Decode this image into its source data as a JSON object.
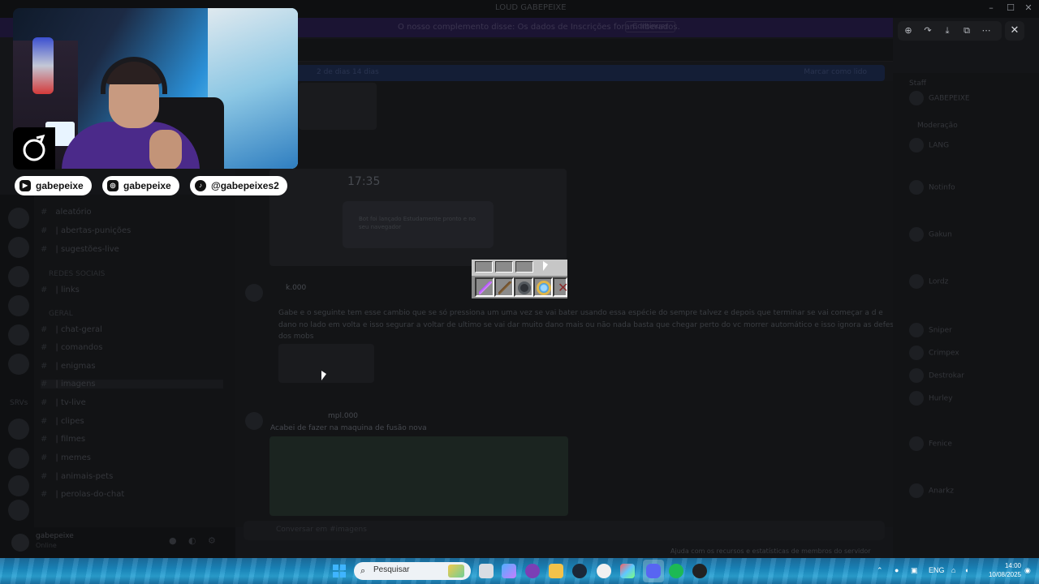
{
  "window": {
    "title": "LOUD GABEPEIXE"
  },
  "discord": {
    "banner_text": "O nosso complemento disse: Os dados de Inscrições foram liberados.",
    "banner_button": "Continuar",
    "notice_left": "2 de dias 14 dias",
    "notice_right": "Marcar como lido",
    "channels": [
      {
        "label": "aleatório",
        "type": "channel"
      },
      {
        "label": "| abertas-punições",
        "type": "channel"
      },
      {
        "label": "| sugestões-live",
        "type": "channel"
      },
      {
        "label": "REDES SOCIAIS",
        "type": "category"
      },
      {
        "label": "| links",
        "type": "channel"
      },
      {
        "label": "GERAL",
        "type": "category"
      },
      {
        "label": "| chat-geral",
        "type": "channel"
      },
      {
        "label": "| comandos",
        "type": "channel"
      },
      {
        "label": "| enigmas",
        "type": "channel"
      },
      {
        "label": "| imagens",
        "type": "channel"
      },
      {
        "label": "| tv-live",
        "type": "channel"
      },
      {
        "label": "| clipes",
        "type": "channel"
      },
      {
        "label": "| filmes",
        "type": "channel"
      },
      {
        "label": "| memes",
        "type": "channel"
      },
      {
        "label": "| animais-pets",
        "type": "channel"
      },
      {
        "label": "| perolas-do-chat",
        "type": "channel"
      }
    ],
    "server_label": "SRVs",
    "user_name": "gabepeixe",
    "user_status": "Online",
    "chat": {
      "time_card": "17:35",
      "notif_line1": "Bot foi lançado Estudamente pronto e no",
      "notif_line2": "seu navegador",
      "msg1_author": "k.000",
      "msg1_text_a": "Gabe e o seguinte tem esse cambio que se só pressiona um uma vez se vai bater usando essa espécie do sempre talvez e depois que terminar se vai começar a d e",
      "msg1_text_b": "dano no lado em volta e isso segurar a voltar de ultimo se vai dar muito dano mais ou não nada basta que chegar perto do vc morrer automático e isso ignora as defesas",
      "msg1_text_c": "dos mobs",
      "msg2_author": "mpl.000",
      "msg2_text": "Acabei de fazer na maquina de fusão nova",
      "composer_placeholder": "Conversar em #imagens"
    },
    "members": [
      "Staff",
      "GABEPEIXE",
      "Moderação",
      "LANG",
      "Notinfo",
      "Gakun",
      "Lordz",
      "Sniper",
      "Crimpex",
      "Destrokar",
      "Hurley",
      "Fenice",
      "Anarkz"
    ],
    "status_bar": "Ajuda com os recursos e estatísticas de membros do servidor"
  },
  "viewer": {
    "tools": [
      "zoom-icon",
      "share-icon",
      "download-icon",
      "open-external-icon",
      "more-icon"
    ],
    "close": "✕"
  },
  "overlay": {
    "socials": [
      {
        "platform": "youtube",
        "handle": "gabepeixe"
      },
      {
        "platform": "instagram",
        "handle": "gabepeixe"
      },
      {
        "platform": "tiktok",
        "handle": "@gabepeixes2"
      }
    ]
  },
  "taskbar": {
    "search_placeholder": "Pesquisar",
    "language": "ENG",
    "time": "14:00",
    "date": "10/08/2025"
  },
  "colors": {
    "accent_purple": "#b04cff",
    "taskbar_blue": "#1a89c0",
    "social_bg": "#ffffff"
  }
}
